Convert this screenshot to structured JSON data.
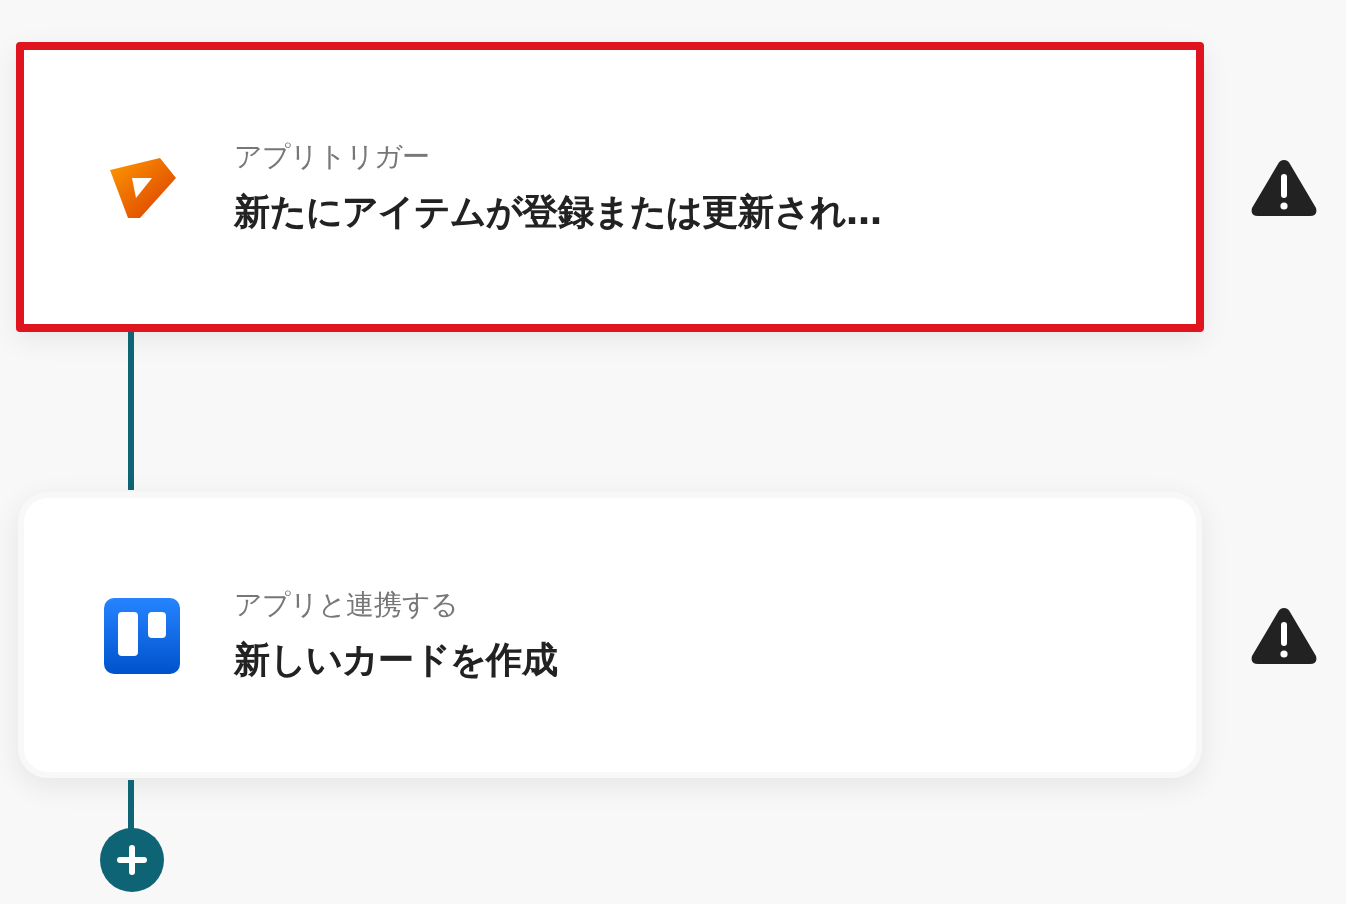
{
  "steps": [
    {
      "kind": "trigger",
      "label": "アプリトリガー",
      "title": "新たにアイテムが登録または更新され…",
      "selected": true,
      "warning": true
    },
    {
      "kind": "action",
      "label": "アプリと連携する",
      "title": "新しいカードを作成",
      "selected": false,
      "warning": true
    }
  ]
}
